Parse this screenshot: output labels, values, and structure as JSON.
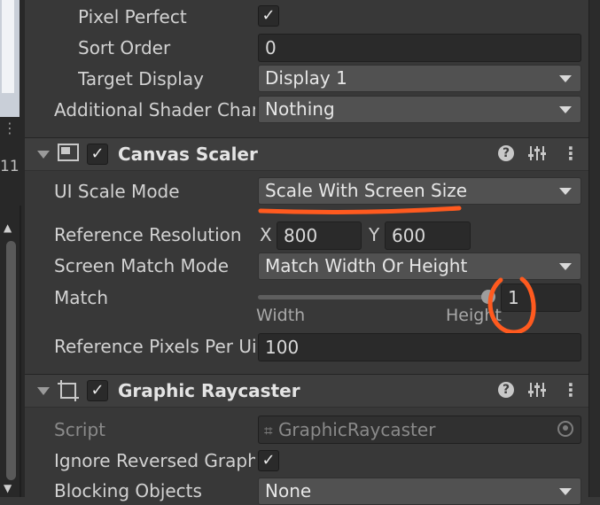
{
  "renderer_section": {
    "pixel_perfect_label": "Pixel Perfect",
    "pixel_perfect_checked": true,
    "sort_order_label": "Sort Order",
    "sort_order_value": "0",
    "target_display_label": "Target Display",
    "target_display_value": "Display 1",
    "additional_shader_label": "Additional Shader Chan",
    "additional_shader_value": "Nothing"
  },
  "canvas_scaler": {
    "title": "Canvas Scaler",
    "enabled": true,
    "ui_scale_mode_label": "UI Scale Mode",
    "ui_scale_mode_value": "Scale With Screen Size",
    "reference_resolution_label": "Reference Resolution",
    "x_label": "X",
    "x_value": "800",
    "y_label": "Y",
    "y_value": "600",
    "screen_match_mode_label": "Screen Match Mode",
    "screen_match_mode_value": "Match Width Or Height",
    "match_label": "Match",
    "match_value": "1",
    "match_slider_fraction": 1.0,
    "width_label": "Width",
    "height_label": "Height",
    "reference_pixels_label": "Reference Pixels Per Ui",
    "reference_pixels_value": "100"
  },
  "graphic_raycaster": {
    "title": "Graphic Raycaster",
    "enabled": true,
    "script_label": "Script",
    "script_value": "GraphicRaycaster",
    "ignore_reversed_label": "Ignore Reversed Graphi",
    "ignore_reversed_checked": true,
    "blocking_objects_label": "Blocking Objects",
    "blocking_objects_value": "None"
  },
  "gutter": {
    "number_text": "11"
  },
  "annotation_colors": {
    "marker": "#ff5a1f"
  },
  "icons": {
    "checkmark": "✓",
    "kebab": "⋮",
    "help": "?"
  }
}
